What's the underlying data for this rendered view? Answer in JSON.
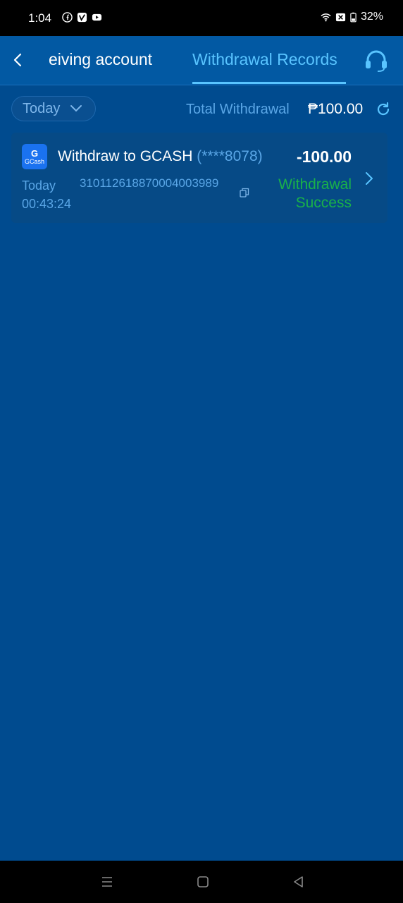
{
  "status_bar": {
    "time": "1:04",
    "battery": "32%",
    "icons": [
      "facebook-icon",
      "vimeo-icon",
      "youtube-icon",
      "wifi-icon",
      "sim-off-icon",
      "battery-icon"
    ]
  },
  "header": {
    "tab_left": "eiving account",
    "tab_right": "Withdrawal Records",
    "back_icon": "chevron-left-icon",
    "support_icon": "headset-icon"
  },
  "filter": {
    "date_label": "Today",
    "total_label": "Total Withdrawal",
    "total_value": "₱100.00"
  },
  "records": [
    {
      "title": "Withdraw to GCASH ",
      "masked_account": "(****8078)",
      "amount": "-100.00",
      "date": "Today",
      "time": "00:43:24",
      "transaction_id": "3101126188700040039​89",
      "status_line1": "Withdrawal",
      "status_line2": "Success",
      "logo_text": "GCash",
      "logo_mark": "G"
    }
  ],
  "colors": {
    "background": "#004b8f",
    "header": "#0259a3",
    "accent": "#59c4ff",
    "muted_text": "#5aa6e6",
    "success": "#19b14a"
  }
}
